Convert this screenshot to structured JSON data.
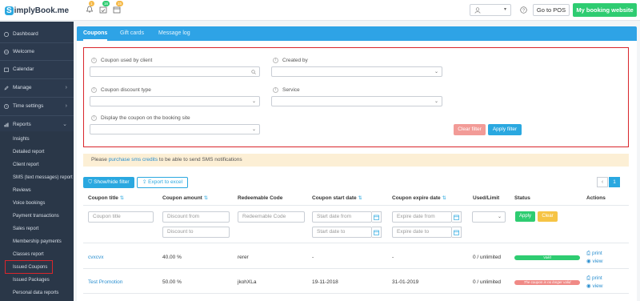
{
  "app": {
    "logo": "implyBook.me",
    "logo_letter": "S"
  },
  "topbar": {
    "badges": [
      {
        "icon": "bell-icon",
        "count": "1",
        "color": "#f5b947"
      },
      {
        "icon": "calendar-check-icon",
        "count": "16",
        "color": "#2ecc71"
      },
      {
        "icon": "calendar-icon",
        "count": "15",
        "color": "#f5b947"
      }
    ],
    "go_to_pos": "Go to POS",
    "my_booking_website": "My booking website"
  },
  "sidebar": {
    "items": [
      {
        "label": "Dashboard",
        "icon": "dashboard-icon"
      },
      {
        "label": "Welcome",
        "icon": "globe-icon"
      },
      {
        "label": "Calendar",
        "icon": "calendar-icon"
      },
      {
        "label": "Manage",
        "icon": "pencil-icon"
      },
      {
        "label": "Time settings",
        "icon": "clock-icon"
      },
      {
        "label": "Reports",
        "icon": "bar-chart-icon"
      }
    ],
    "reports_sub": [
      "Insights",
      "Detailed report",
      "Client report",
      "SMS (text messages) report",
      "Reviews",
      "Voice bookings",
      "Payment transactions",
      "Sales report",
      "Membership payments",
      "Classes report",
      "Issued Coupons",
      "Issued Packages",
      "Personal data reports"
    ]
  },
  "tabs": [
    "Coupons",
    "Gift cards",
    "Message log"
  ],
  "filter": {
    "coupon_used_by_client": "Coupon used by client",
    "created_by": "Created by",
    "coupon_discount_type": "Coupon discount type",
    "service": "Service",
    "display_coupon": "Display the coupon on the booking site",
    "clear_filter": "Clear filter",
    "apply_filter": "Apply filter"
  },
  "notice": {
    "before": "Please ",
    "link": "purchase sms credits",
    "after": " to be able to send SMS notifications"
  },
  "toolbar": {
    "show_hide_filter": "Show/hide filter",
    "export": "Export to excel",
    "prev": "‹",
    "page": "1"
  },
  "table": {
    "headers": [
      "Coupon title",
      "Coupon amount",
      "Redeemable Code",
      "Coupon start date",
      "Coupon expire date",
      "Used/Limit",
      "Status",
      "Actions"
    ],
    "filters": {
      "coupon_title": "Coupon title",
      "discount_from": "Discount from",
      "discount_to": "Discount to",
      "redeemable_code": "Redeemable Code",
      "start_date_from": "Start date from",
      "start_date_to": "Start date to",
      "expire_date_from": "Expire date from",
      "expire_date_to": "Expire date to",
      "apply": "Apply",
      "clear": "Clear"
    },
    "rows": [
      {
        "title": "cvxcvx",
        "amount": "40.00 %",
        "code": "rerer",
        "start": "-",
        "expire": "-",
        "used": "0 / unlimited",
        "status": "Valid",
        "status_color": "#2ecc71",
        "print": "print",
        "view": "view"
      },
      {
        "title": "Test Promotion",
        "amount": "50.00 %",
        "code": "jkohXLa",
        "start": "19-11-2018",
        "expire": "31-01-2019",
        "used": "0 / unlimited",
        "status": "The coupon is no longer valid",
        "status_color": "#f08a86",
        "print": "print",
        "view": "view"
      }
    ]
  }
}
